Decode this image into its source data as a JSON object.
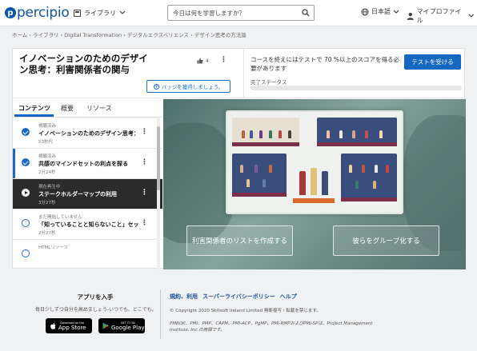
{
  "header": {
    "logo_text": "percipio",
    "library_label": "ライブラリ",
    "search_placeholder": "今日は何を学習しますか？",
    "language_label": "日本語",
    "profile_label": "マイプロファイル"
  },
  "breadcrumb": "ホーム › ライブラリ › Digital Transformation › デジタルエクスペリエンス › デザイン思考の方法論",
  "course": {
    "title": "イノベーションのためのデザイン思考：利害関係者の関与",
    "likes": "4",
    "badge_button": "バッジを獲得しましょう。",
    "status_message": "コースを終えにはテストで 70 %以上のスコアを得る必要があります",
    "test_button": "テストを受ける",
    "status_label": "完了ステータス",
    "progress": 0
  },
  "tabs": [
    "コンテンツ",
    "概要",
    "リソース"
  ],
  "items": [
    {
      "meta": "視聴済み",
      "name": "イノベーションのためのデザイン思考：利害関係者の関与",
      "dur": "53秒代",
      "state": "done"
    },
    {
      "meta": "視聴済み",
      "name": "共感のマインドセットの利点を探る",
      "dur": "2分24秒",
      "state": "done"
    },
    {
      "meta": "現在再生中",
      "name": "ステークホルダーマップの利用",
      "dur": "3分27秒",
      "state": "current"
    },
    {
      "meta": "まだ開始していません",
      "name": "「知っていることと知らないこと」セッションの実施",
      "dur": "2分27秒",
      "state": "open"
    },
    {
      "meta": "HTMLリソース",
      "name": "",
      "dur": "",
      "state": "open"
    }
  ],
  "video": {
    "button_left": "利害関係者のリストを作成する",
    "button_right": "彼らをグループ化する"
  },
  "footer": {
    "app_title": "アプリを入手",
    "app_sub": "毎日少しずつ自分を高めましょう-いつでも、どこでも。",
    "appstore_small": "Download on the",
    "appstore_big": "App Store",
    "googleplay_small": "GET IT ON",
    "googleplay_big": "Google Play",
    "links": [
      "規約、利用",
      "スーパーライバシーポリシー",
      "ヘルプ"
    ],
    "copyright": "© Copyright 2020 Skillsoft Ireland Limited 無断複写・転載を禁じます。",
    "trademark": "PMBOK、PMI、PMP、CAPM、PMI-ACP、PgMP、PMI-RMPおよびPMI-SPは、Project Management Institute, Inc.の商標です。"
  }
}
